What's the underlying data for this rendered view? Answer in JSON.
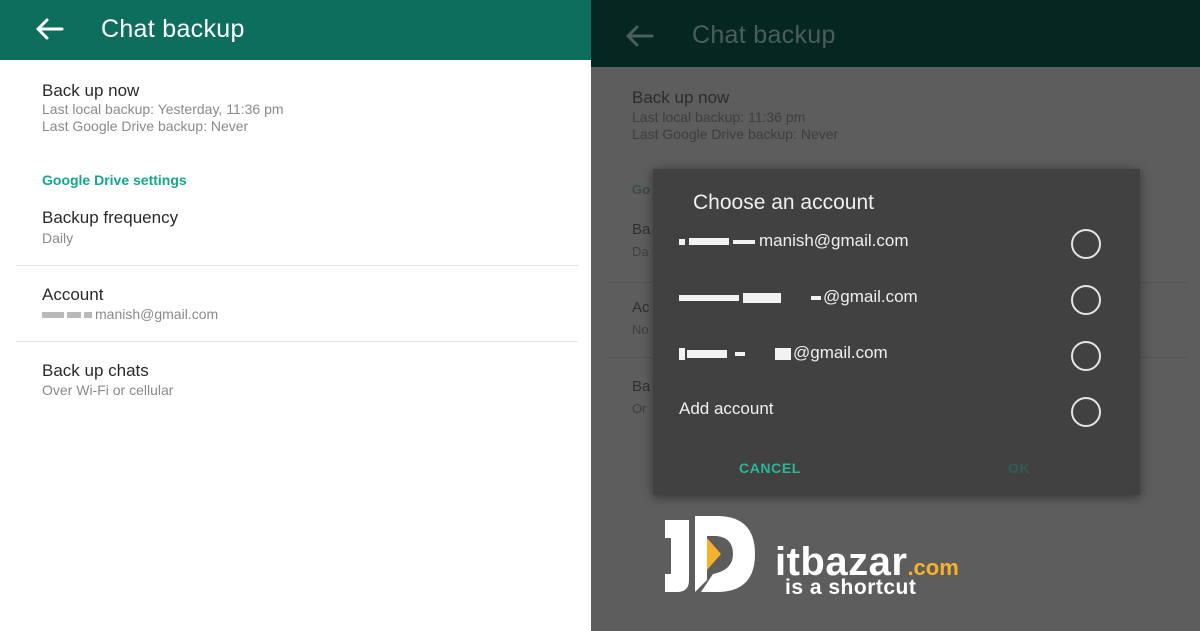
{
  "colors": {
    "toolbar_light": "#0e6e5e",
    "toolbar_dimmed": "#062622",
    "accent": "#13a88b",
    "dialog_bg": "#414141",
    "logo_accent": "#f5b22a"
  },
  "left_screen": {
    "appbar": {
      "back_icon": "arrow-left-icon",
      "title": "Chat backup"
    },
    "back_up_now": {
      "title": "Back up now",
      "last_local": "Last local backup: Yesterday, 11:36 pm",
      "last_drive": "Last Google Drive backup: Never"
    },
    "section_header": "Google Drive settings",
    "frequency": {
      "title": "Backup frequency",
      "value": "Daily"
    },
    "account": {
      "title": "Account",
      "value": "manish@gmail.com"
    },
    "back_up_chats": {
      "title": "Back up chats",
      "value": "Over Wi-Fi or cellular"
    }
  },
  "right_screen": {
    "appbar": {
      "back_icon": "arrow-left-icon",
      "title": "Chat backup"
    },
    "back_up_now": {
      "title": "Back up now",
      "last_local": "Last local backup: 11:36 pm",
      "last_drive": "Last Google Drive backup: Never"
    },
    "obscured_fragments": {
      "section_header": "Go",
      "frequency_title": "Ba",
      "frequency_value": "Da",
      "account_title": "Ac",
      "account_value": "No",
      "chats_title": "Ba",
      "chats_value": "Or"
    },
    "dialog": {
      "title": "Choose an account",
      "accounts": [
        {
          "label": "manish@gmail.com",
          "selected": false
        },
        {
          "label": "@gmail.com",
          "selected": false
        },
        {
          "label": "@gmail.com",
          "selected": false
        }
      ],
      "add_account": {
        "label": "Add account",
        "selected": false
      },
      "cancel": "CANCEL",
      "ok": "OK"
    }
  },
  "watermark": {
    "brand": "itbazar",
    "tld": ".com",
    "tagline": "is a shortcut"
  }
}
